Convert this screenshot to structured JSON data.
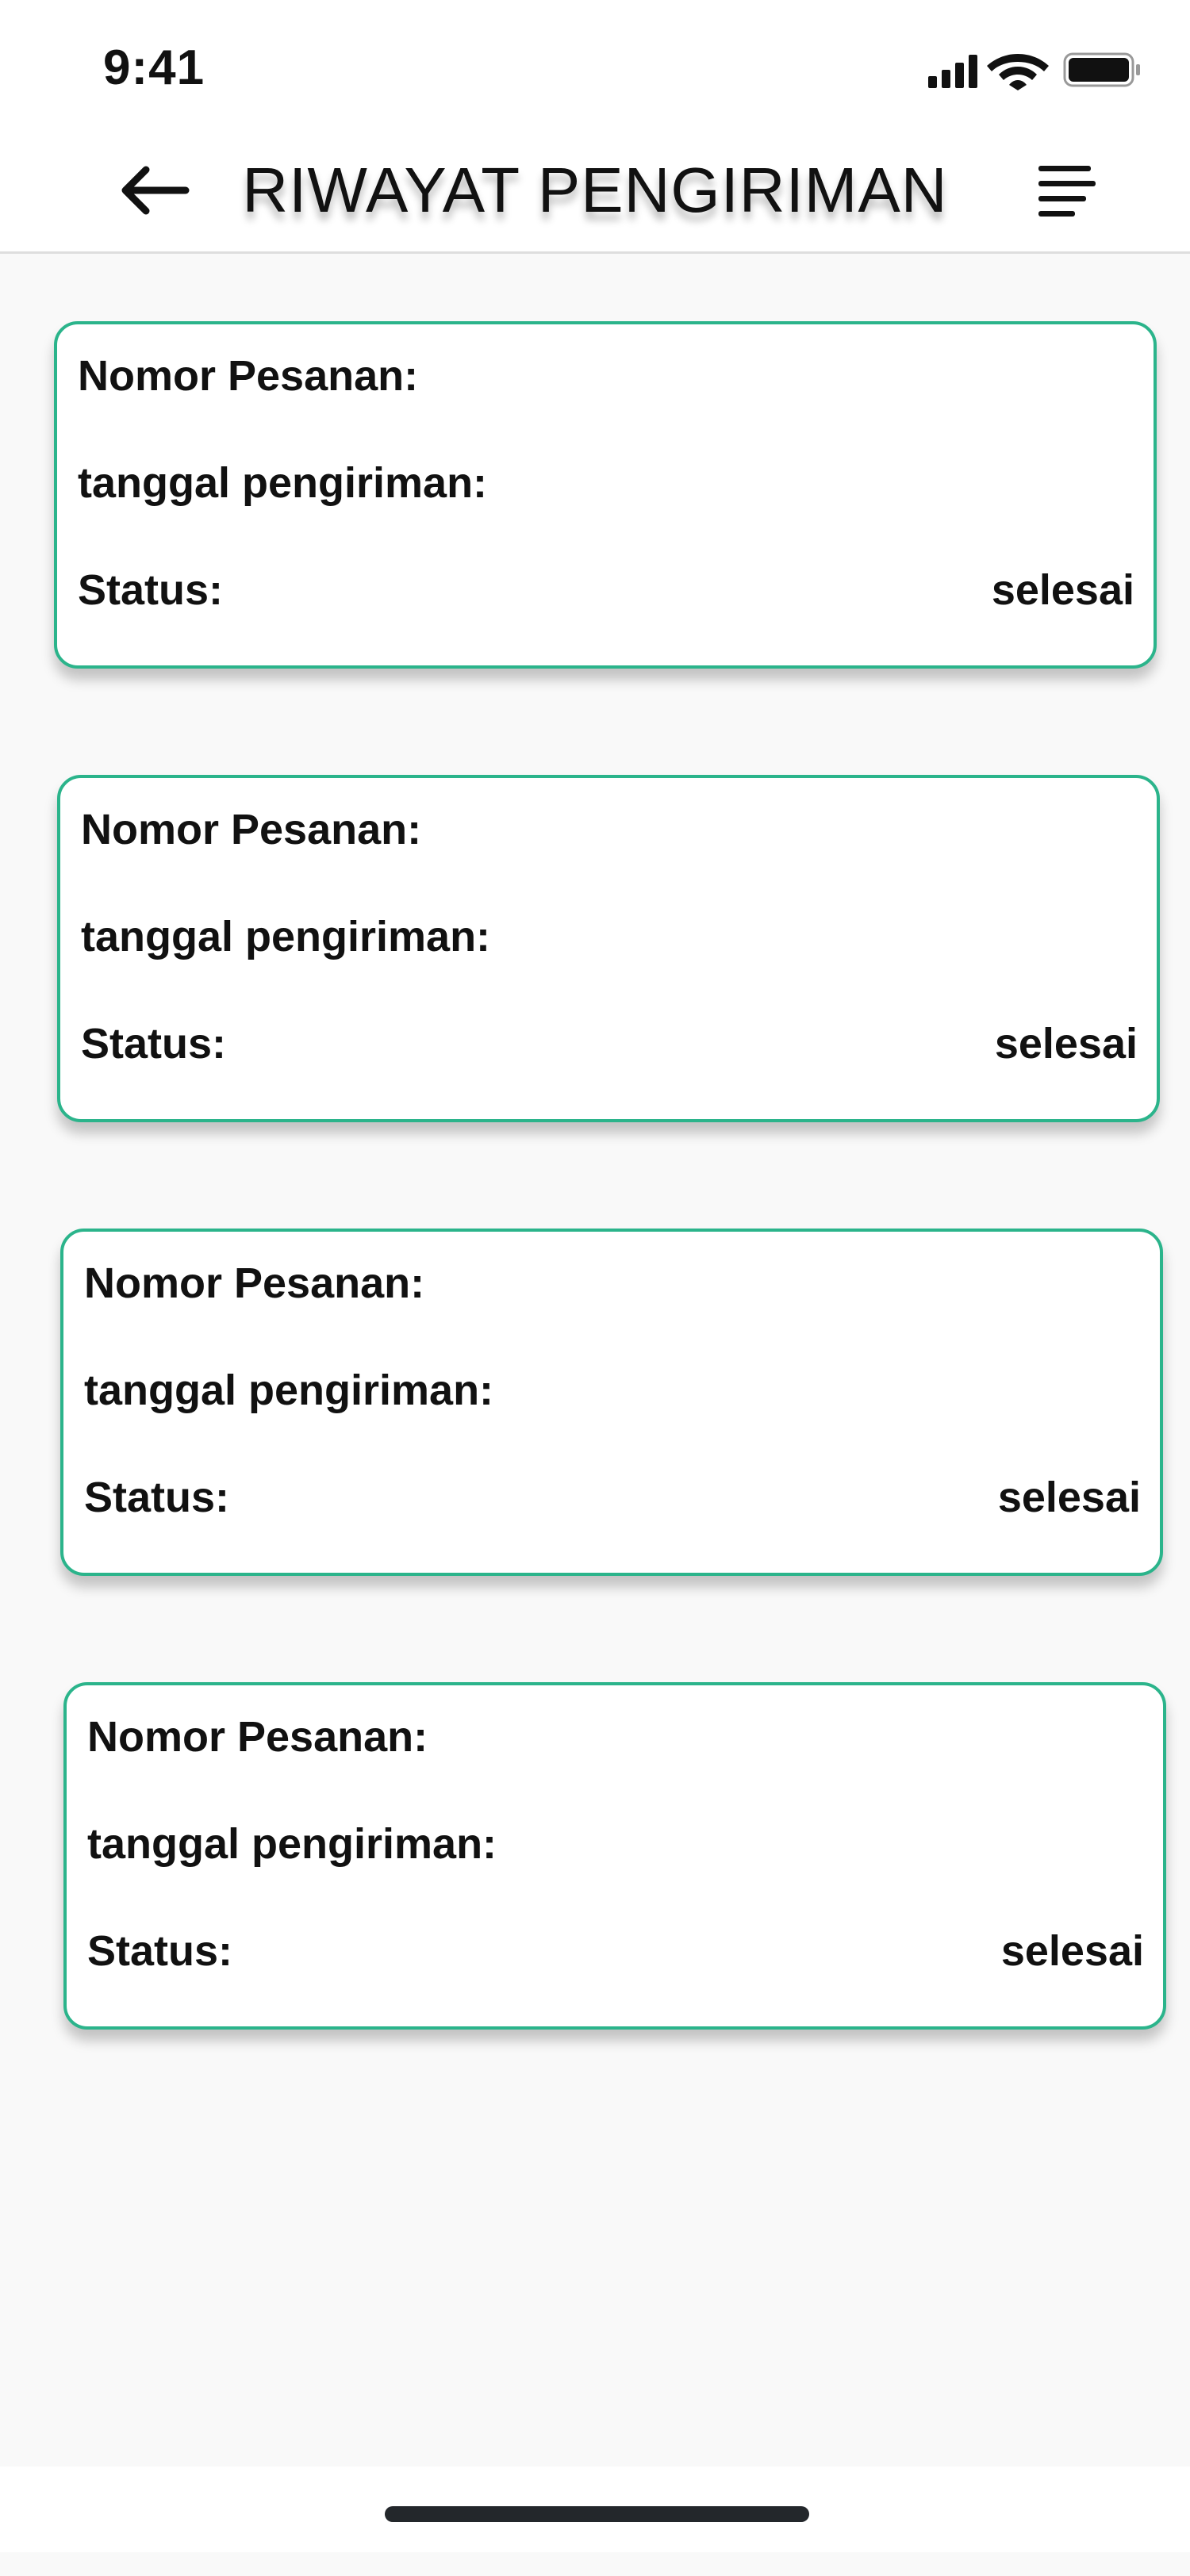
{
  "status_bar": {
    "time": "9:41",
    "icons": [
      "cellular-signal-icon",
      "wifi-icon",
      "battery-icon"
    ]
  },
  "header": {
    "title": "RIWAYAT PENGIRIMAN",
    "back_icon": "arrow-left-icon",
    "menu_icon": "text-align-menu-icon"
  },
  "colors": {
    "card_border": "#2bb48b",
    "background": "#f9f9f9",
    "text": "#111111"
  },
  "orders": [
    {
      "order_number_label": "Nomor Pesanan:",
      "shipping_date_label": "tanggal pengiriman:",
      "status_label": "Status:",
      "status_value": "selesai"
    },
    {
      "order_number_label": "Nomor Pesanan:",
      "shipping_date_label": "tanggal pengiriman:",
      "status_label": "Status:",
      "status_value": "selesai"
    },
    {
      "order_number_label": "Nomor Pesanan:",
      "shipping_date_label": "tanggal pengiriman:",
      "status_label": "Status:",
      "status_value": "selesai"
    },
    {
      "order_number_label": "Nomor Pesanan:",
      "shipping_date_label": "tanggal pengiriman:",
      "status_label": "Status:",
      "status_value": "selesai"
    }
  ]
}
